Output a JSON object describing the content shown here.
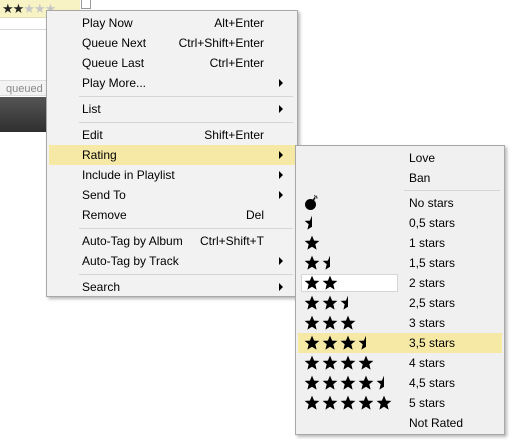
{
  "background": {
    "rating_filled": 2,
    "rating_total": 5,
    "queued_text": "queued"
  },
  "context_menu": {
    "items": [
      {
        "label": "Play Now",
        "shortcut": "Alt+Enter",
        "submenu": false
      },
      {
        "label": "Queue Next",
        "shortcut": "Ctrl+Shift+Enter",
        "submenu": false
      },
      {
        "label": "Queue Last",
        "shortcut": "Ctrl+Enter",
        "submenu": false
      },
      {
        "label": "Play More...",
        "shortcut": "",
        "submenu": true
      },
      {
        "label": "List",
        "shortcut": "",
        "submenu": true
      },
      {
        "label": "Edit",
        "shortcut": "Shift+Enter",
        "submenu": false
      },
      {
        "label": "Rating",
        "shortcut": "",
        "submenu": true,
        "highlighted": true
      },
      {
        "label": "Include in Playlist",
        "shortcut": "",
        "submenu": true
      },
      {
        "label": "Send To",
        "shortcut": "",
        "submenu": true
      },
      {
        "label": "Remove",
        "shortcut": "Del",
        "submenu": false
      },
      {
        "label": "Auto-Tag by Album",
        "shortcut": "Ctrl+Shift+T",
        "submenu": false
      },
      {
        "label": "Auto-Tag by Track",
        "shortcut": "",
        "submenu": true
      },
      {
        "label": "Search",
        "shortcut": "",
        "submenu": true
      }
    ]
  },
  "rating_submenu": {
    "items": [
      {
        "label": "Love",
        "stars": null
      },
      {
        "label": "Ban",
        "stars": null
      },
      {
        "label": "No stars",
        "stars": 0,
        "icon": "bomb-icon"
      },
      {
        "label": "0,5 stars",
        "stars": 0.5
      },
      {
        "label": "1 stars",
        "stars": 1
      },
      {
        "label": "1,5 stars",
        "stars": 1.5
      },
      {
        "label": "2 stars",
        "stars": 2,
        "current": true
      },
      {
        "label": "2,5 stars",
        "stars": 2.5
      },
      {
        "label": "3 stars",
        "stars": 3
      },
      {
        "label": "3,5 stars",
        "stars": 3.5,
        "highlighted": true
      },
      {
        "label": "4 stars",
        "stars": 4
      },
      {
        "label": "4,5 stars",
        "stars": 4.5
      },
      {
        "label": "5 stars",
        "stars": 5
      },
      {
        "label": "Not Rated",
        "stars": null
      }
    ]
  },
  "colors": {
    "highlight": "#f5e9a5",
    "menu_bg": "#f2f2f2",
    "rating_cell_bg": "#f7f3c4"
  }
}
